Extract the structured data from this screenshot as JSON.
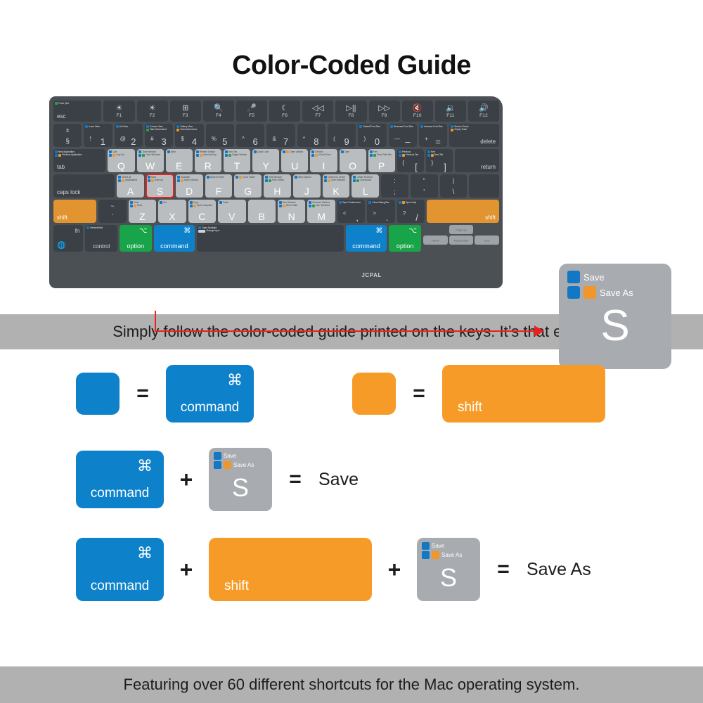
{
  "page": {
    "title": "Color-Coded Guide",
    "banner_top": "Simply follow the color-coded guide printed on the keys. It’s that easy!",
    "banner_bottom": "Featuring over 60 different shortcuts for the Mac operating system.",
    "brand": "JCPAL"
  },
  "colors": {
    "blue": "#0D82CA",
    "orange": "#F79B28",
    "green": "#18A54A",
    "key_grey": "#A8ABAF",
    "keyboard_body": "#4B5055",
    "dark_key": "#3A4045",
    "highlight_red": "#E8221C",
    "banner_grey": "#B1B1B1"
  },
  "magnified_key": {
    "letter": "S",
    "hints": [
      {
        "squares": [
          "blue"
        ],
        "label": "Save"
      },
      {
        "squares": [
          "blue",
          "orange"
        ],
        "label": "Save As"
      }
    ]
  },
  "legend": {
    "row1": {
      "left": {
        "swatch": "blue",
        "equals": "=",
        "key": {
          "glyph": "⌘",
          "name": "command"
        }
      },
      "right": {
        "swatch": "orange",
        "equals": "=",
        "key": {
          "glyph": "",
          "name": "shift"
        }
      }
    },
    "row2": {
      "key1": {
        "glyph": "⌘",
        "name": "command"
      },
      "plus": "+",
      "key2": {
        "letter": "S",
        "hints": [
          {
            "squares": [
              "blue"
            ],
            "label": "Save"
          },
          {
            "squares": [
              "blue",
              "orange"
            ],
            "label": "Save As"
          }
        ]
      },
      "equals": "=",
      "result": "Save"
    },
    "row3": {
      "key1": {
        "glyph": "⌘",
        "name": "command"
      },
      "plus1": "+",
      "key2": {
        "name": "shift"
      },
      "plus2": "+",
      "key3": {
        "letter": "S",
        "hints": [
          {
            "squares": [
              "blue"
            ],
            "label": "Save"
          },
          {
            "squares": [
              "blue",
              "orange"
            ],
            "label": "Save As"
          }
        ]
      },
      "equals": "=",
      "result": "Save As"
    }
  },
  "keyboard": {
    "function_row": [
      {
        "label": "esc",
        "type": "word",
        "hints": [
          {
            "squares": [
              "green"
            ],
            "label": "Force Quit"
          }
        ]
      },
      {
        "icon": "☀",
        "label": "F1",
        "hint_name": "brightness-down-icon"
      },
      {
        "icon": "☀",
        "label": "F2",
        "hint_name": "brightness-up-icon"
      },
      {
        "icon": "⊞",
        "label": "F3",
        "hint_name": "mission-control-icon"
      },
      {
        "icon": "🔍",
        "label": "F4",
        "hint_name": "search-icon"
      },
      {
        "icon": "🎤",
        "label": "F5",
        "hint_name": "dictation-icon"
      },
      {
        "icon": "☾",
        "label": "F6",
        "hint_name": "do-not-disturb-icon"
      },
      {
        "icon": "◁◁",
        "label": "F7",
        "hint_name": "rewind-icon"
      },
      {
        "icon": "▷||",
        "label": "F8",
        "hint_name": "play-pause-icon"
      },
      {
        "icon": "▷▷",
        "label": "F9",
        "hint_name": "fast-forward-icon"
      },
      {
        "icon": "🔇",
        "label": "F10",
        "hint_name": "mute-icon"
      },
      {
        "icon": "🔉",
        "label": "F11",
        "hint_name": "volume-down-icon"
      },
      {
        "icon": "🔊",
        "label": "F12",
        "hint_name": "volume-up-icon"
      }
    ],
    "number_row": [
      {
        "top": "±",
        "bottom": "§",
        "dark": true
      },
      {
        "top": "!",
        "main": "1",
        "hints": [
          {
            "squares": [
              "blue"
            ],
            "label": "Icons View"
          }
        ]
      },
      {
        "top": "@",
        "main": "2",
        "hints": [
          {
            "squares": [
              "blue"
            ],
            "label": "List View"
          }
        ]
      },
      {
        "top": "#",
        "main": "3",
        "hints": [
          {
            "squares": [
              "blue"
            ],
            "label": "Column View"
          },
          {
            "squares": [
              "green"
            ],
            "label": "Take Screenshot"
          }
        ]
      },
      {
        "top": "$",
        "main": "4",
        "hints": [
          {
            "squares": [
              "blue"
            ],
            "label": "Gallery View"
          },
          {
            "squares": [
              "orange"
            ],
            "label": "Screenshot Area"
          }
        ]
      },
      {
        "top": "%",
        "main": "5"
      },
      {
        "top": "^",
        "main": "6"
      },
      {
        "top": "&",
        "main": "7"
      },
      {
        "top": "*",
        "main": "8"
      },
      {
        "top": "(",
        "main": "9"
      },
      {
        "top": ")",
        "main": "0",
        "hints": [
          {
            "squares": [
              "blue"
            ],
            "label": "Default Font Size"
          }
        ]
      },
      {
        "top": "—",
        "main": "–",
        "hints": [
          {
            "squares": [
              "blue"
            ],
            "label": "Decrease Font Size"
          }
        ]
      },
      {
        "top": "+",
        "main": "=",
        "hints": [
          {
            "squares": [
              "blue"
            ],
            "label": "Increase Font Size"
          }
        ]
      },
      {
        "label": "delete",
        "type": "word",
        "dark": true,
        "hints": [
          {
            "squares": [
              "blue"
            ],
            "label": "Move to Trash"
          },
          {
            "squares": [
              "orange"
            ],
            "label": "Empty Trash"
          }
        ]
      }
    ],
    "q_row": [
      {
        "label": "tab",
        "type": "word",
        "dark": true,
        "hints": [
          {
            "squares": [
              "blue"
            ],
            "label": "Next Application"
          },
          {
            "squares": [
              "blue",
              "orange"
            ],
            "label": "Previous Application"
          }
        ]
      },
      {
        "letter": "Q",
        "hints": [
          {
            "squares": [
              "blue"
            ],
            "label": "Quit"
          },
          {
            "squares": [
              "blue",
              "orange"
            ],
            "label": "Log Out"
          }
        ]
      },
      {
        "letter": "W",
        "hints": [
          {
            "squares": [
              "blue"
            ],
            "label": "Close Window"
          },
          {
            "squares": [
              "blue",
              "green"
            ],
            "label": "Close Windows"
          }
        ]
      },
      {
        "letter": "E",
        "hints": [
          {
            "squares": [
              "blue"
            ],
            "label": "Eject"
          }
        ]
      },
      {
        "letter": "R",
        "hints": [
          {
            "squares": [
              "blue"
            ],
            "label": "Refresh Default"
          },
          {
            "squares": [
              "blue",
              "orange"
            ],
            "label": "Open AirDrop"
          }
        ]
      },
      {
        "letter": "T",
        "hints": [
          {
            "squares": [
              "blue"
            ],
            "label": "New Tab"
          },
          {
            "squares": [
              "blue",
              "green"
            ],
            "label": "Toggle Sidebar"
          }
        ]
      },
      {
        "letter": "Y",
        "hints": [
          {
            "squares": [
              "blue"
            ],
            "label": "Quick Look"
          }
        ]
      },
      {
        "letter": "U",
        "hints": [
          {
            "squares": [
              "blue",
              "orange"
            ],
            "label": "Open Utilities"
          }
        ]
      },
      {
        "letter": "I",
        "hints": [
          {
            "squares": [
              "blue"
            ],
            "label": "Get Info"
          },
          {
            "squares": [
              "blue",
              "orange"
            ],
            "label": "iCloud Drive"
          }
        ]
      },
      {
        "letter": "O",
        "hints": [
          {
            "squares": [
              "blue"
            ],
            "label": "Open"
          }
        ]
      },
      {
        "letter": "P",
        "hints": [
          {
            "squares": [
              "blue"
            ],
            "label": "Print"
          },
          {
            "squares": [
              "blue",
              "green"
            ],
            "label": "Show Path Bar"
          }
        ]
      },
      {
        "top": "{",
        "bottom": "[",
        "dark": true,
        "hints": [
          {
            "squares": [
              "blue"
            ],
            "label": "Previous"
          },
          {
            "squares": [
              "blue",
              "orange"
            ],
            "label": "Previous Tab"
          }
        ]
      },
      {
        "top": "}",
        "bottom": "]",
        "dark": true,
        "hints": [
          {
            "squares": [
              "blue"
            ],
            "label": "Next"
          },
          {
            "squares": [
              "blue",
              "orange"
            ],
            "label": "Next Tab"
          }
        ]
      },
      {
        "label": "return",
        "type": "word",
        "dark": true
      }
    ],
    "a_row": [
      {
        "label": "caps lock",
        "type": "word",
        "dark": true
      },
      {
        "letter": "A",
        "hints": [
          {
            "squares": [
              "blue"
            ],
            "label": "Select All"
          },
          {
            "squares": [
              "blue",
              "orange"
            ],
            "label": "Applications"
          }
        ]
      },
      {
        "letter": "S",
        "selected": true,
        "hints": [
          {
            "squares": [
              "blue"
            ],
            "label": "Save"
          },
          {
            "squares": [
              "blue",
              "orange"
            ],
            "label": "Save As"
          }
        ]
      },
      {
        "letter": "D",
        "hints": [
          {
            "squares": [
              "blue"
            ],
            "label": "Duplicate"
          },
          {
            "squares": [
              "blue",
              "orange"
            ],
            "label": "Open Desktop"
          }
        ]
      },
      {
        "letter": "F",
        "hints": [
          {
            "squares": [
              "blue"
            ],
            "label": "Search Finder"
          }
        ]
      },
      {
        "letter": "G",
        "hints": [
          {
            "squares": [
              "blue",
              "orange"
            ],
            "label": "Go to Folder"
          }
        ]
      },
      {
        "letter": "H",
        "hints": [
          {
            "squares": [
              "blue"
            ],
            "label": "Hide Window"
          },
          {
            "squares": [
              "blue",
              "green"
            ],
            "label": "Hide Others"
          }
        ]
      },
      {
        "letter": "J",
        "hints": [
          {
            "squares": [
              "blue"
            ],
            "label": "View Options"
          }
        ]
      },
      {
        "letter": "K",
        "hints": [
          {
            "squares": [
              "blue"
            ],
            "label": "Connect to Server"
          },
          {
            "squares": [
              "blue",
              "orange"
            ],
            "label": "Open Network"
          }
        ]
      },
      {
        "letter": "L",
        "hints": [
          {
            "squares": [
              "blue"
            ],
            "label": "Create Shortcut"
          },
          {
            "squares": [
              "blue",
              "green"
            ],
            "label": "Downloads"
          }
        ]
      },
      {
        "top": ":",
        "bottom": ";",
        "dark": true
      },
      {
        "top": "\"",
        "bottom": "'",
        "dark": true
      },
      {
        "top": "|",
        "bottom": "\\",
        "dark": true
      }
    ],
    "z_row": [
      {
        "label": "shift",
        "type": "word",
        "color": "orange"
      },
      {
        "top": "~",
        "bottom": "`",
        "dark": true
      },
      {
        "letter": "Z",
        "hints": [
          {
            "squares": [
              "blue"
            ],
            "label": "Undo"
          },
          {
            "squares": [
              "blue",
              "orange"
            ],
            "label": "Redo"
          }
        ]
      },
      {
        "letter": "X",
        "hints": [
          {
            "squares": [
              "blue"
            ],
            "label": "Cut"
          }
        ]
      },
      {
        "letter": "C",
        "hints": [
          {
            "squares": [
              "blue"
            ],
            "label": "Copy"
          },
          {
            "squares": [
              "blue",
              "orange"
            ],
            "label": "Open Computer"
          }
        ]
      },
      {
        "letter": "V",
        "hints": [
          {
            "squares": [
              "blue"
            ],
            "label": "Paste"
          }
        ]
      },
      {
        "letter": "B",
        "hints": []
      },
      {
        "letter": "N",
        "hints": [
          {
            "squares": [
              "blue"
            ],
            "label": "New Window"
          },
          {
            "squares": [
              "blue",
              "orange"
            ],
            "label": "New Folder"
          }
        ]
      },
      {
        "letter": "M",
        "hints": [
          {
            "squares": [
              "blue"
            ],
            "label": "Minimize Window"
          },
          {
            "squares": [
              "blue",
              "green"
            ],
            "label": "Min. Windows"
          }
        ]
      },
      {
        "top": "<",
        "bottom": ",",
        "dark": true,
        "hints": [
          {
            "squares": [
              "blue"
            ],
            "label": "Open Preferences"
          }
        ]
      },
      {
        "top": ">",
        "bottom": ".",
        "dark": true,
        "hints": [
          {
            "squares": [
              "blue"
            ],
            "label": "Close Dialog Box"
          }
        ]
      },
      {
        "top": "?",
        "bottom": "/",
        "dark": true,
        "hints": [
          {
            "squares": [
              "blue",
              "orange"
            ],
            "label": "Open Help"
          }
        ]
      },
      {
        "label": "shift",
        "type": "word",
        "color": "orange",
        "align": "right"
      }
    ],
    "bottom_row": {
      "fn": {
        "label": "fn",
        "icon": "🌐"
      },
      "control": {
        "label": "control",
        "hints": [
          {
            "squares": [
              "blue"
            ],
            "label": "Restart/Hold"
          }
        ]
      },
      "option_left": {
        "glyph": "⌥",
        "label": "option",
        "color": "green"
      },
      "command_left": {
        "glyph": "⌘",
        "label": "command",
        "color": "blue"
      },
      "space": {
        "hints": [
          {
            "squares": [
              "blue"
            ],
            "label": "Open Spotlight"
          },
          {
            "squares": [
              "grey"
            ],
            "label": "Change Input"
          }
        ]
      },
      "command_right": {
        "glyph": "⌘",
        "label": "command",
        "color": "blue"
      },
      "option_right": {
        "glyph": "⌥",
        "label": "option",
        "color": "green"
      },
      "arrows": {
        "up": "Page Up",
        "left": "Home",
        "down": "Page Down",
        "right": "End"
      }
    }
  }
}
